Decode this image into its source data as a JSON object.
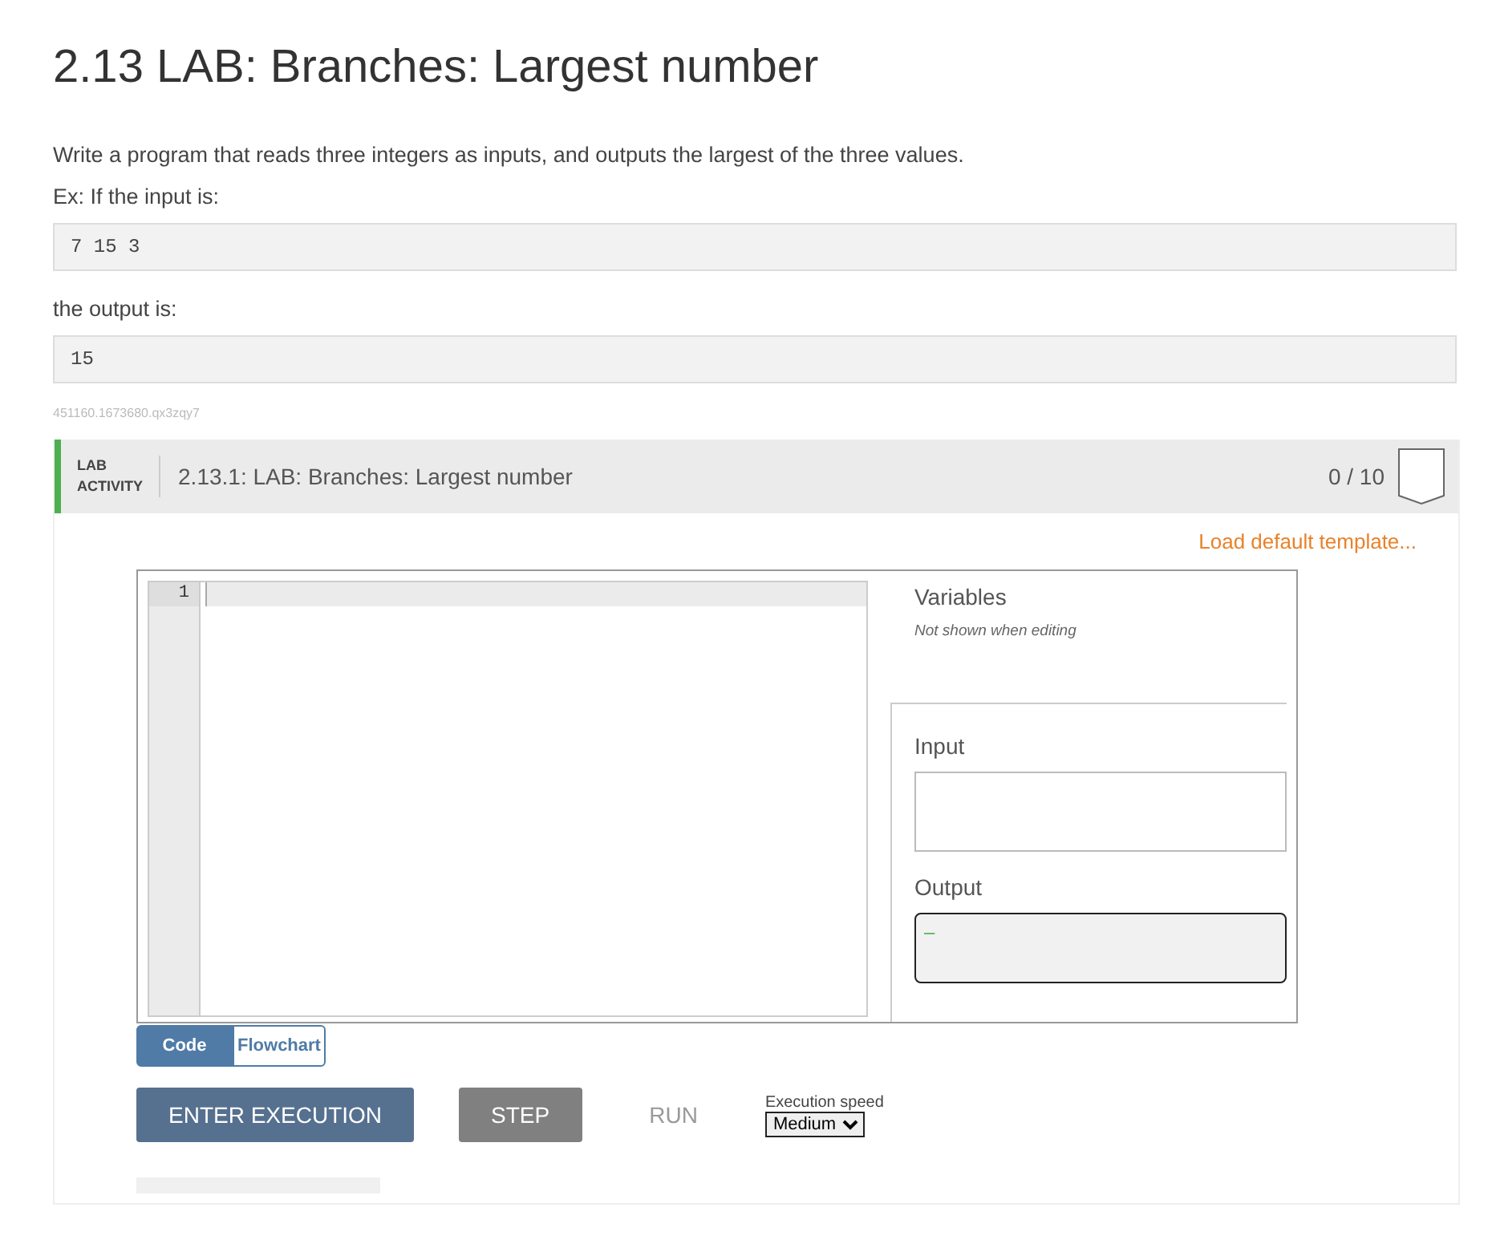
{
  "title": "2.13 LAB: Branches: Largest number",
  "description": "Write a program that reads three integers as inputs, and outputs the largest of the three values.",
  "example_intro": "Ex: If the input is:",
  "example_input": "7 15 3",
  "output_intro": "the output is:",
  "example_output": "15",
  "reference_id": "451160.1673680.qx3zqy7",
  "lab": {
    "badge": [
      "LAB",
      "ACTIVITY"
    ],
    "title": "2.13.1: LAB: Branches: Largest number",
    "score": "0 / 10",
    "load_template": "Load default template...",
    "editor": {
      "line_numbers": [
        "1"
      ]
    },
    "variables": {
      "heading": "Variables",
      "note": "Not shown when editing"
    },
    "input": {
      "label": "Input"
    },
    "output": {
      "label": "Output",
      "value": "–"
    },
    "tabs": [
      {
        "label": "Code",
        "selected": true
      },
      {
        "label": "Flowchart",
        "selected": false
      }
    ],
    "buttons": [
      {
        "label": "ENTER EXECUTION",
        "kind": "primary",
        "disabled": false
      },
      {
        "label": "STEP",
        "kind": "secondary",
        "disabled": false
      },
      {
        "label": "RUN",
        "kind": "text",
        "disabled": true
      }
    ],
    "speed": {
      "label": "Execution speed",
      "value": "Medium"
    }
  }
}
